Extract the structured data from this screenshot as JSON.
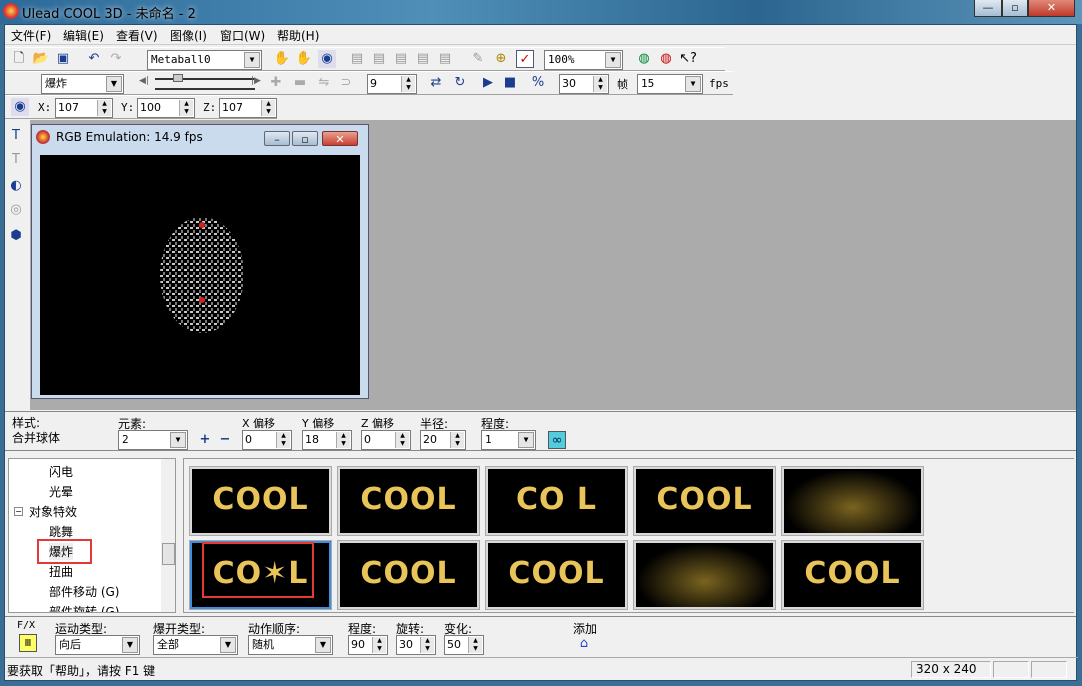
{
  "window": {
    "title": "Ulead COOL 3D - 未命名 - 2",
    "minimize": "—",
    "maximize": "▫",
    "close": "✕"
  },
  "menu": [
    "文件(F)",
    "编辑(E)",
    "查看(V)",
    "图像(I)",
    "窗口(W)",
    "帮助(H)"
  ],
  "toolbar1": {
    "object_select": "Metaball0",
    "zoom": "100%"
  },
  "toolbar2": {
    "effect": "爆炸",
    "frame": "9",
    "fps_frames": "30",
    "frame_label": "帧",
    "fps_value": "15",
    "fps_label": "fps"
  },
  "toolbar3": {
    "x_label": "X:",
    "x": "107",
    "y_label": "Y:",
    "y": "100",
    "z_label": "Z:",
    "z": "107"
  },
  "child_window": {
    "title": "RGB Emulation: 14.9 fps"
  },
  "attr_panel": {
    "style_label": "样式:",
    "style_value": "合并球体",
    "elements_label": "元素:",
    "elements": "2",
    "x_offset_label": "X 偏移",
    "x_offset": "0",
    "y_offset_label": "Y 偏移",
    "y_offset": "18",
    "z_offset_label": "Z 偏移",
    "z_offset": "0",
    "radius_label": "半径:",
    "radius": "20",
    "degree_label": "程度:",
    "degree": "1"
  },
  "tree": {
    "items": [
      "闪电",
      "光晕",
      "对象特效",
      "跳舞",
      "爆炸",
      "扭曲",
      "部件移动 (G)",
      "部件旋转 (G)"
    ],
    "selected": "爆炸"
  },
  "gallery": {
    "thumbs": [
      "COOL",
      "COOL",
      "CO  L",
      "COOL",
      "",
      "CO✶L",
      "COOL",
      "COOL",
      "",
      "COOL"
    ],
    "selected_index": 5
  },
  "params": {
    "fx_label": "F/X",
    "motion_label": "运动类型:",
    "motion": "向后",
    "burst_label": "爆开类型:",
    "burst": "全部",
    "order_label": "动作顺序:",
    "order": "随机",
    "degree_label": "程度:",
    "degree": "90",
    "rotate_label": "旋转:",
    "rotate": "30",
    "change_label": "变化:",
    "change": "50",
    "add_label": "添加"
  },
  "status": {
    "help": "要获取「帮助」，请按 F1 键",
    "size": "320 x 240"
  },
  "colors": {
    "highlight": "#e53935",
    "thumb_text": "#e9c458",
    "workspace": "#ababab"
  }
}
